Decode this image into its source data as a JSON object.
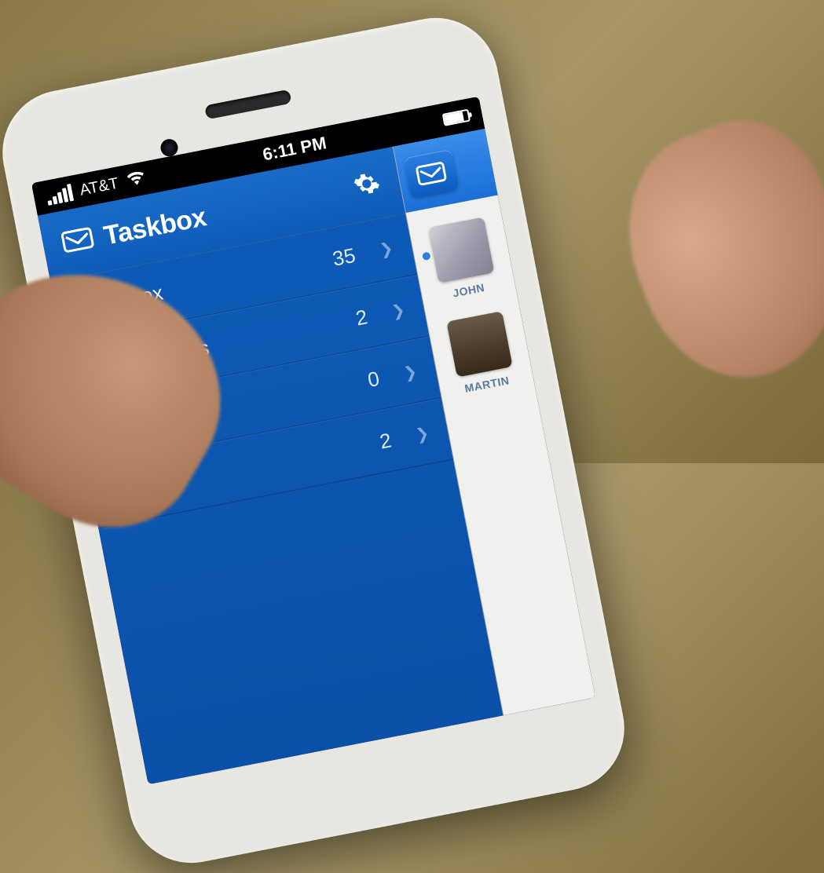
{
  "status": {
    "carrier": "AT&T",
    "time": "6:11 PM"
  },
  "app": {
    "brand": "Taskbox",
    "nav": [
      {
        "label": "Inbox",
        "count": "35"
      },
      {
        "label": "My Tasks",
        "count": "2"
      },
      {
        "label": "",
        "count": "0"
      },
      {
        "label": "",
        "count": "2"
      }
    ],
    "contacts": [
      {
        "name": "JOHN"
      },
      {
        "name": "MARTIN"
      }
    ]
  }
}
